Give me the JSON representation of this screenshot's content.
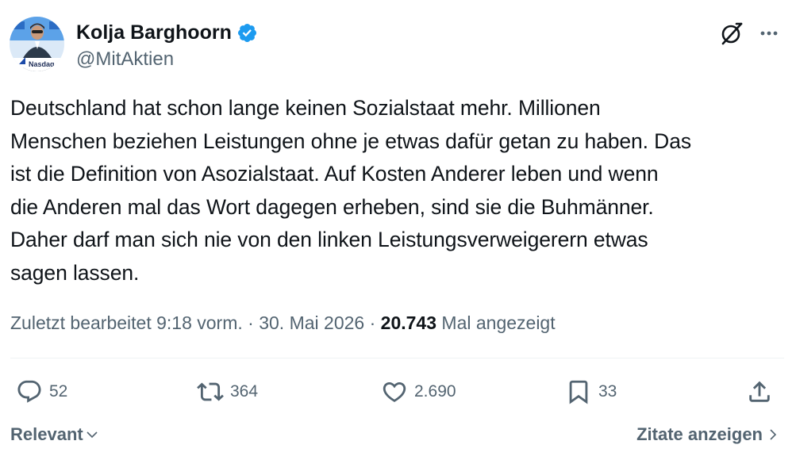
{
  "author": {
    "display_name": "Kolja Barghoorn",
    "handle": "@MitAktien",
    "avatar_caption": "Nasdaq"
  },
  "post": {
    "text": "Deutschland hat schon lange keinen Sozialstaat mehr. Millionen\nMenschen beziehen Leistungen ohne je etwas dafür getan zu haben. Das\nist die Definition von Asozialstaat. Auf Kosten Anderer leben und wenn\ndie Anderen mal das Wort dagegen erheben, sind sie die Buhmänner.\nDaher darf man sich nie von den linken Leistungsverweigerern etwas\nsagen lassen."
  },
  "meta": {
    "edited_label": "Zuletzt bearbeitet",
    "time": "9:18 vorm.",
    "sep1": "·",
    "date": "30. Mai 2026",
    "sep2": "·",
    "views_count": "20.743",
    "views_label": "Mal angezeigt"
  },
  "actions": {
    "replies": "52",
    "reposts": "364",
    "likes": "2.690",
    "bookmarks": "33"
  },
  "footer": {
    "sort_label": "Relevant",
    "quotes_label": "Zitate anzeigen"
  },
  "icons": {
    "verified": "verified-badge-icon",
    "grok": "grok-icon",
    "more": "more-icon",
    "reply": "reply-icon",
    "repost": "repost-icon",
    "like": "heart-icon",
    "bookmark": "bookmark-icon",
    "share": "share-icon"
  },
  "colors": {
    "verified_blue": "#1d9bf0",
    "text_primary": "#0f1419",
    "text_secondary": "#536471",
    "divider": "#eff3f4"
  }
}
